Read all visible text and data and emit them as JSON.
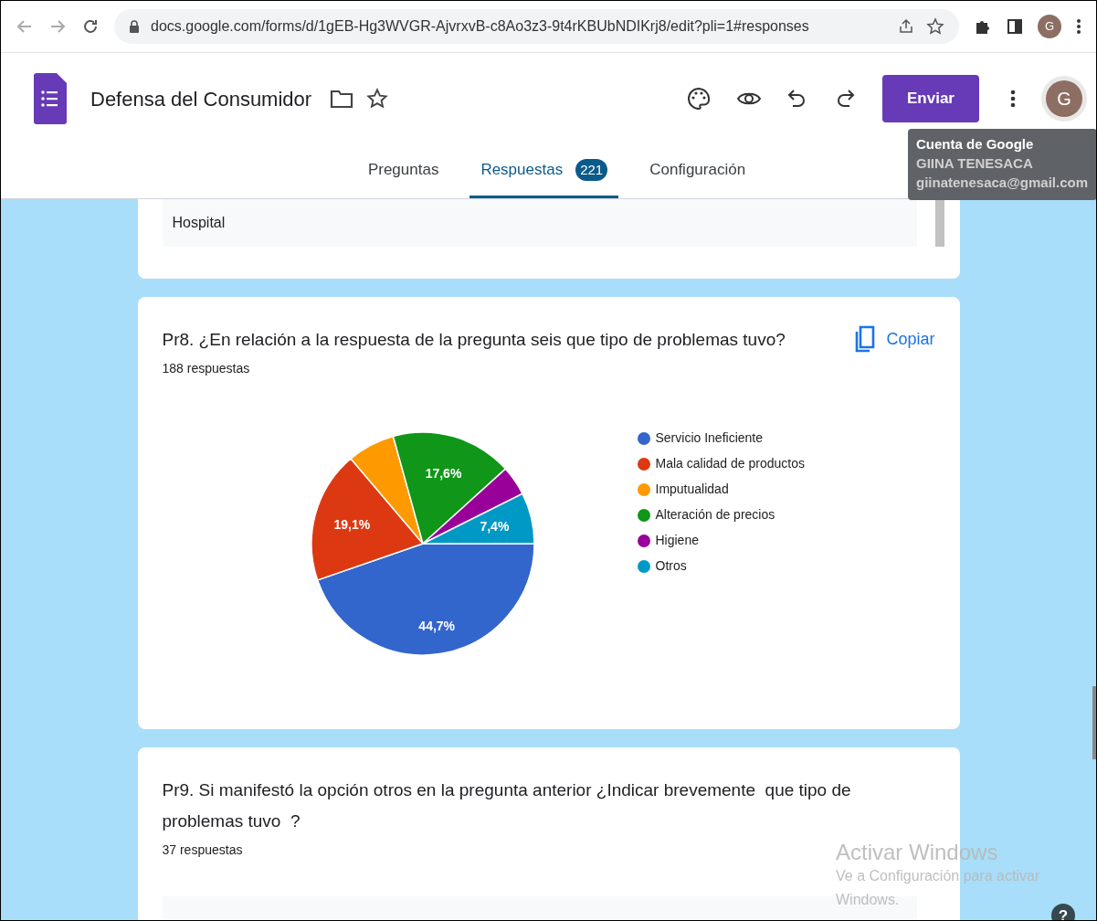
{
  "browser": {
    "url": "docs.google.com/forms/d/1gEB-Hg3WVGR-AjvrxvB-c8Ao3z3-9t4rKBUbNDIKrj8/edit?pli=1#responses",
    "avatar_letter": "G"
  },
  "header": {
    "title": "Defensa del Consumidor",
    "send_button": "Enviar",
    "avatar_letter": "G"
  },
  "tabs": [
    {
      "label": "Preguntas",
      "selected": false
    },
    {
      "label": "Respuestas",
      "selected": true,
      "badge": "221"
    },
    {
      "label": "Configuración",
      "selected": false
    }
  ],
  "tooltip": {
    "title": "Cuenta de Google",
    "name": "GIINA TENESACA",
    "email": "giinatenesaca@gmail.com"
  },
  "previous_answer": "Hospital",
  "questions": [
    {
      "title": "Pr8. ¿En relación a la respuesta de la pregunta seis que tipo de problemas tuvo?",
      "count": "188 respuestas",
      "copy_button": "Copiar",
      "chart_data": {
        "type": "pie",
        "categories": [
          "Servicio Ineficiente",
          "Mala calidad de productos",
          "Imputualidad",
          "Alteración de precios",
          "Higiene",
          "Otros"
        ],
        "values": [
          44.7,
          19.1,
          6.9,
          17.6,
          4.3,
          7.4
        ],
        "legend": "right",
        "colors": [
          "#3366cc",
          "#dc3912",
          "#ff9900",
          "#109618",
          "#990099",
          "#0099c6"
        ],
        "value_labels": [
          "44,7%",
          "19,1%",
          null,
          "17,6%",
          null,
          "7,4%"
        ]
      }
    },
    {
      "title": "Pr9. Si manifestó la opción otros en la pregunta anterior ¿Indicar brevemente  que tipo de problemas tuvo  ?",
      "count": "37 respuestas"
    }
  ],
  "os_notice": {
    "title": "Activar Windows",
    "text": "Ve a Configuración para activar Windows."
  },
  "help_button": "?"
}
